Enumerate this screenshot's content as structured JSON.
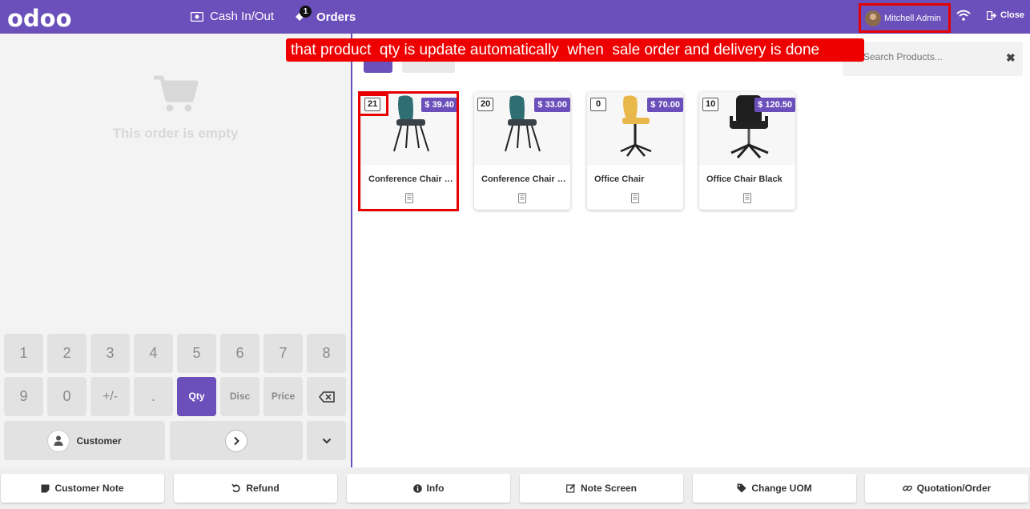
{
  "topbar": {
    "logo": "odoo",
    "cash_label": "Cash In/Out",
    "orders_label": "Orders",
    "orders_count": "1",
    "user_name": "Mitchell Admin",
    "close_label": "Close"
  },
  "left": {
    "empty_text": "This order is empty"
  },
  "keypad": {
    "keys": [
      "1",
      "2",
      "3",
      "4",
      "5",
      "6",
      "7",
      "8",
      "9",
      "0",
      "+/-",
      ".",
      "Qty",
      "Disc",
      "Price"
    ],
    "customer_label": "Customer"
  },
  "search": {
    "placeholder": "Search Products..."
  },
  "products": [
    {
      "qty": "21",
      "price": "$ 39.40",
      "name": "Conference Chair (Aluminium)"
    },
    {
      "qty": "20",
      "price": "$ 33.00",
      "name": "Conference Chair (Steel)"
    },
    {
      "qty": "0",
      "price": "$ 70.00",
      "name": "Office Chair"
    },
    {
      "qty": "10",
      "price": "$ 120.50",
      "name": "Office Chair Black"
    }
  ],
  "banner": "that product  qty is update automatically  when  sale order and delivery is done",
  "bottom": {
    "customer_note": "Customer Note",
    "refund": "Refund",
    "info": "Info",
    "note_screen": "Note Screen",
    "change_uom": "Change UOM",
    "quotation_order": "Quotation/Order"
  },
  "colors": {
    "brand": "#6b4fbb",
    "highlight": "#e60000"
  }
}
